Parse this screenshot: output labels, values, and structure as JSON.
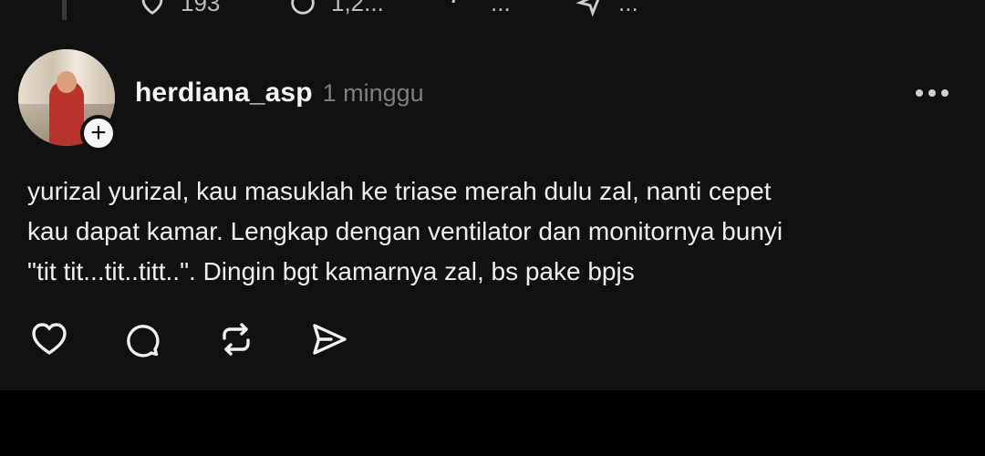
{
  "app": {
    "background": "#000000",
    "card_color": "#111112"
  },
  "previous_post": {
    "actions": [
      {
        "icon": "heart-icon",
        "count": "193"
      },
      {
        "icon": "comment-icon",
        "count": "1,2..."
      },
      {
        "icon": "repost-icon",
        "count": "..."
      },
      {
        "icon": "share-icon",
        "count": "..."
      }
    ]
  },
  "post": {
    "username": "herdiana_asp",
    "time": "1 minggu",
    "text": "yurizal yurizal, kau masuklah ke triase merah dulu zal, nanti cepet\nkau dapat kamar. Lengkap dengan ventilator dan monitornya bunyi\n\"tit tit...tit..titt..\". Dingin bgt kamarnya zal, bs pake bpjs",
    "follow_badge": "+",
    "actions": [
      "heart-icon",
      "comment-icon",
      "repost-icon",
      "share-icon"
    ]
  }
}
